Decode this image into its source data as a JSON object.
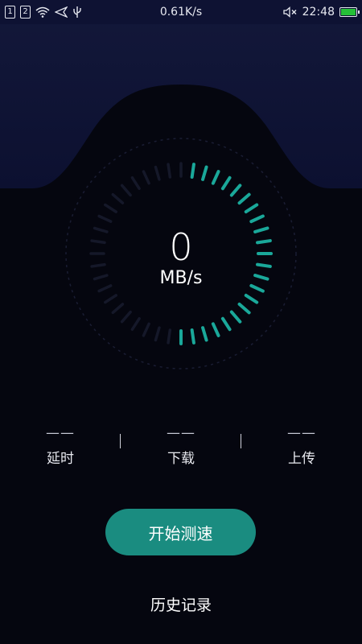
{
  "status_bar": {
    "sim1": "1",
    "sim2": "2",
    "net_speed": "0.61K/s",
    "time": "22:48",
    "battery_color": "#25c037",
    "icons": [
      "sim-icon",
      "wifi-icon",
      "send-icon",
      "usb-icon",
      "mute-icon",
      "battery-icon"
    ]
  },
  "gauge": {
    "value": "0",
    "unit": "MB/s",
    "accent": "#1aa89a"
  },
  "stats": {
    "latency": {
      "value": "——",
      "label": "延时"
    },
    "download": {
      "value": "——",
      "label": "下载"
    },
    "upload": {
      "value": "——",
      "label": "上传"
    }
  },
  "actions": {
    "start_label": "开始测速",
    "history_label": "历史记录",
    "button_color": "#1a8c80"
  }
}
